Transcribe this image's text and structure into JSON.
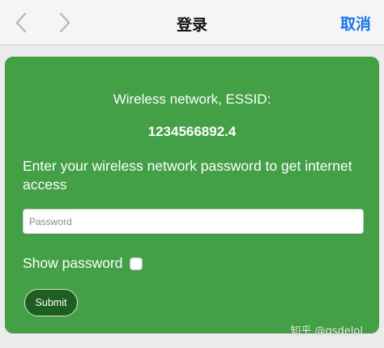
{
  "navbar": {
    "title": "登录",
    "cancel_label": "取消",
    "back_icon": "chevron-left-icon",
    "forward_icon": "chevron-right-icon"
  },
  "form": {
    "essid_label": "Wireless network, ESSID:",
    "essid_value": "1234566892.4",
    "instructions": "Enter your wireless network password to get internet access",
    "password_placeholder": "Password",
    "password_value": "",
    "show_password_label": "Show password",
    "show_password_checked": false,
    "submit_label": "Submit"
  },
  "watermark": "知乎 @qsdelol",
  "colors": {
    "card_background": "#43a047",
    "submit_background": "#1f5e21",
    "accent": "#1a73e8"
  }
}
